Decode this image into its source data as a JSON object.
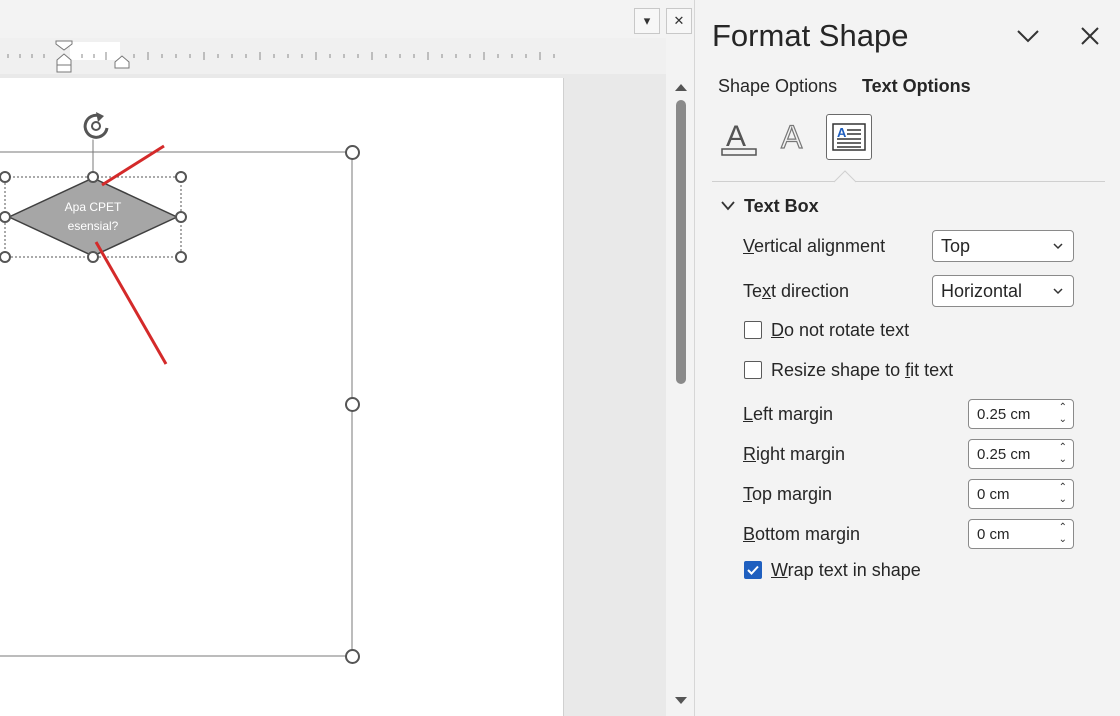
{
  "window": {
    "dropdown_label": "▾",
    "close_label": "✕"
  },
  "document": {
    "shape_text_line1": "Apa CPET",
    "shape_text_line2": "esensial?"
  },
  "pane": {
    "title": "Format Shape",
    "collapse_label": "⌵",
    "close_label": "✕",
    "tabs": {
      "shape_options": "Shape Options",
      "text_options": "Text Options"
    },
    "section": {
      "title": "Text Box",
      "vertical_alignment": {
        "label": "Vertical alignment",
        "value": "Top"
      },
      "text_direction": {
        "label_pre": "Te",
        "label_acc": "x",
        "label_post": "t direction",
        "value": "Horizontal"
      },
      "do_not_rotate": {
        "acc": "D",
        "rest": "o not rotate text",
        "checked": false
      },
      "resize_shape": {
        "pre": "Resize shape to ",
        "acc": "f",
        "post": "it text",
        "checked": false
      },
      "left_margin": {
        "acc": "L",
        "rest": "eft margin",
        "value": "0.25 cm"
      },
      "right_margin": {
        "acc": "R",
        "rest": "ight margin",
        "value": "0.25 cm"
      },
      "top_margin": {
        "acc": "T",
        "rest": "op margin",
        "value": "0 cm"
      },
      "bottom_margin": {
        "acc": "B",
        "rest": "ottom margin",
        "value": "0 cm"
      },
      "wrap_text": {
        "acc": "W",
        "rest": "rap text in shape",
        "checked": true
      }
    }
  },
  "colors": {
    "accent": "#1f5fbf",
    "connector_red": "#d42a2a",
    "diamond_fill": "#a6a6a6"
  }
}
